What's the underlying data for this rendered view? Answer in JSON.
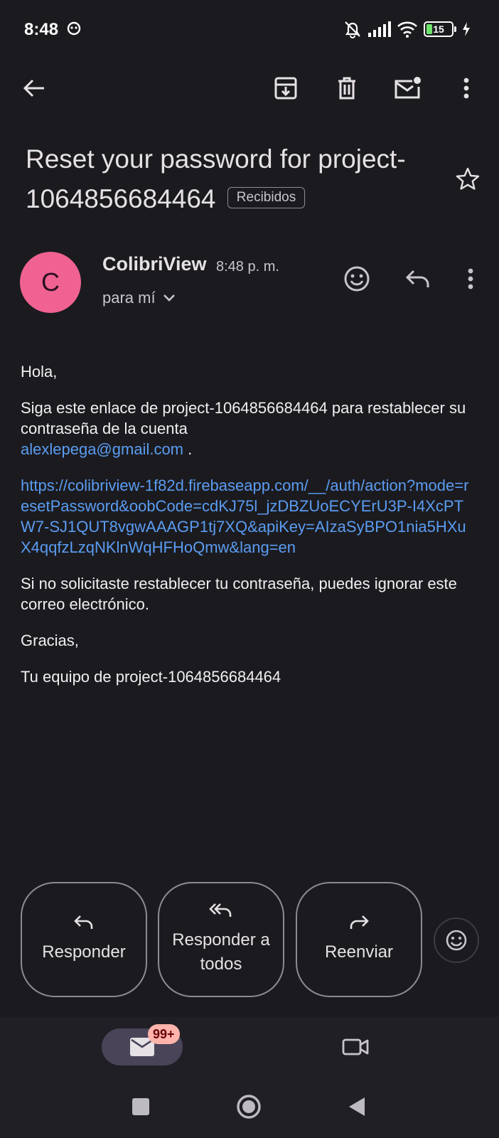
{
  "status_bar": {
    "time": "8:48",
    "battery_level": "15"
  },
  "email": {
    "subject": "Reset your password for project-1064856684464",
    "label": "Recibidos",
    "sender": {
      "avatar_letter": "C",
      "name": "ColibriView",
      "time": "8:48 p. m.",
      "recipient": "para mí"
    },
    "body": {
      "greeting": "Hola,",
      "intro": "Siga este enlace de project-1064856684464 para restablecer su contraseña de la cuenta",
      "email_link": "alexlepega@gmail.com",
      "period": ".",
      "reset_url": "https://colibriview-1f82d.firebaseapp.com/__/auth/action?mode=resetPassword&oobCode=cdKJ75l_jzDBZUoECYErU3P-I4XcPTW7-SJ1QUT8vgwAAAGP1tj7XQ&apiKey=AIzaSyBPO1nia5HXuX4qqfzLzqNKlnWqHFHoQmw&lang=en",
      "ignore_note": "Si no solicitaste restablecer tu contraseña, puedes ignorar este correo electrónico.",
      "thanks": "Gracias,",
      "signature": "Tu equipo de project-1064856684464"
    }
  },
  "actions": {
    "reply": "Responder",
    "reply_all": "Responder a todos",
    "forward": "Reenviar"
  },
  "bottom_nav": {
    "mail_badge": "99+"
  },
  "colors": {
    "background": "#1b1b1f",
    "avatar": "#f06292",
    "link": "#5b9cf2",
    "badge": "#ffb4ab",
    "battery": "#6ee36e"
  }
}
